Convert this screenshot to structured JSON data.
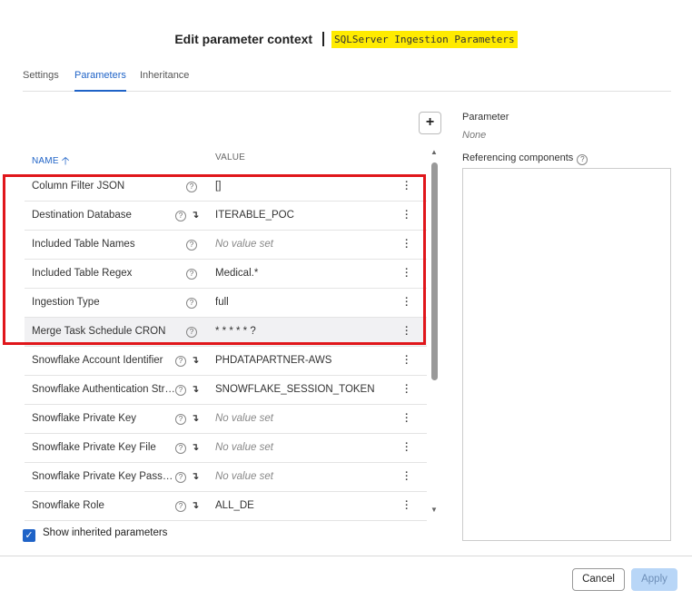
{
  "header": {
    "title": "Edit parameter context",
    "context_name": "SQLServer Ingestion Parameters"
  },
  "tabs": [
    {
      "label": "Settings",
      "active": false
    },
    {
      "label": "Parameters",
      "active": true
    },
    {
      "label": "Inheritance",
      "active": false
    }
  ],
  "table": {
    "name_header": "NAME",
    "value_header": "VALUE",
    "rows": [
      {
        "name": "Column Filter JSON",
        "value": "[]",
        "empty": false,
        "inherited": false,
        "highlighted": false
      },
      {
        "name": "Destination Database",
        "value": "ITERABLE_POC",
        "empty": false,
        "inherited": true,
        "highlighted": false
      },
      {
        "name": "Included Table Names",
        "value": "No value set",
        "empty": true,
        "inherited": false,
        "highlighted": false
      },
      {
        "name": "Included Table Regex",
        "value": "Medical.*",
        "empty": false,
        "inherited": false,
        "highlighted": false
      },
      {
        "name": "Ingestion Type",
        "value": "full",
        "empty": false,
        "inherited": false,
        "highlighted": false
      },
      {
        "name": "Merge Task Schedule CRON",
        "value": "* * * * * ?",
        "empty": false,
        "inherited": false,
        "highlighted": true
      },
      {
        "name": "Snowflake Account Identifier",
        "value": "PHDATAPARTNER-AWS",
        "empty": false,
        "inherited": true,
        "highlighted": false
      },
      {
        "name": "Snowflake Authentication Strategy",
        "value": "SNOWFLAKE_SESSION_TOKEN",
        "empty": false,
        "inherited": true,
        "highlighted": false
      },
      {
        "name": "Snowflake Private Key",
        "value": "No value set",
        "empty": true,
        "inherited": true,
        "highlighted": false
      },
      {
        "name": "Snowflake Private Key File",
        "value": "No value set",
        "empty": true,
        "inherited": true,
        "highlighted": false
      },
      {
        "name": "Snowflake Private Key Password",
        "value": "No value set",
        "empty": true,
        "inherited": true,
        "highlighted": false
      },
      {
        "name": "Snowflake Role",
        "value": "ALL_DE",
        "empty": false,
        "inherited": true,
        "highlighted": false
      }
    ]
  },
  "show_inherited": {
    "label": "Show inherited parameters",
    "checked": true
  },
  "side": {
    "parameter_label": "Parameter",
    "parameter_value": "None",
    "referencing_label": "Referencing components"
  },
  "footer": {
    "cancel_label": "Cancel",
    "apply_label": "Apply"
  },
  "colors": {
    "accent": "#1f63c7",
    "highlight_border": "#e0161b",
    "context_highlight": "#ffeb00"
  }
}
